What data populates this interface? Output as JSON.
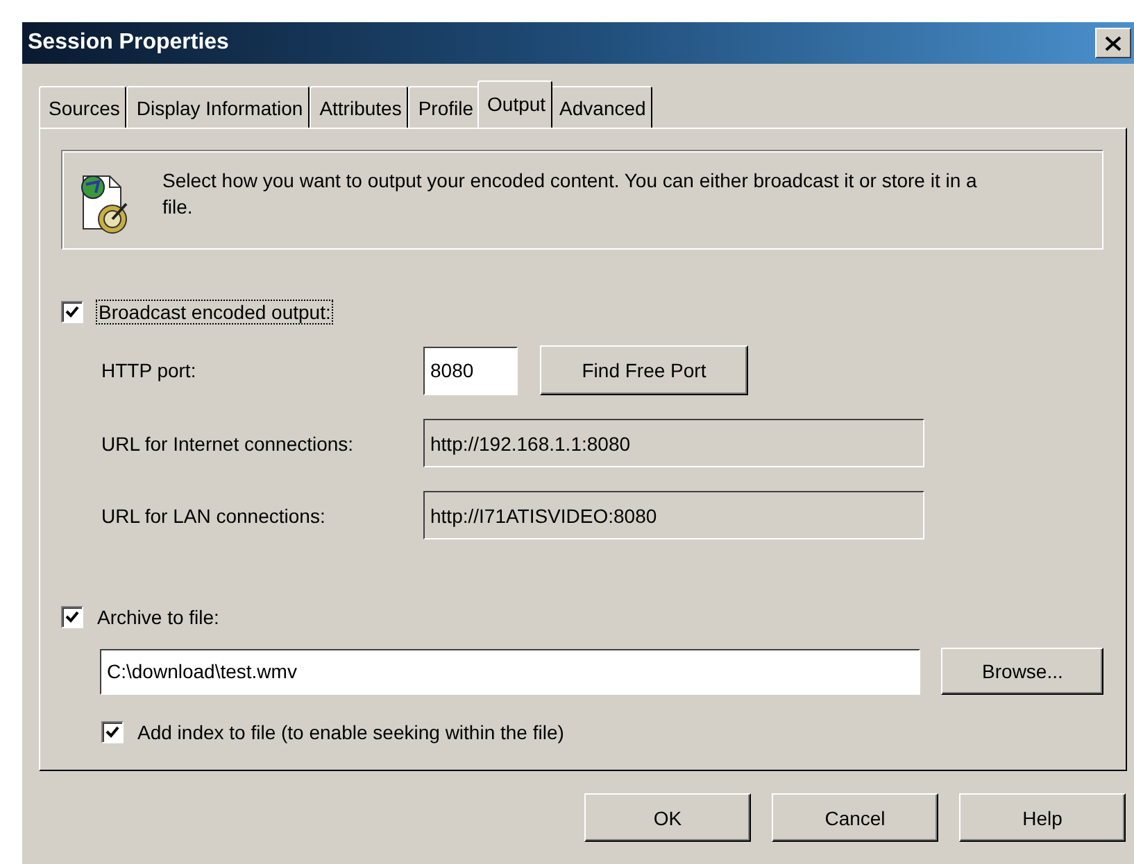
{
  "window": {
    "title": "Session Properties"
  },
  "tabs": [
    {
      "label": "Sources",
      "selected": false
    },
    {
      "label": "Display Information",
      "selected": false
    },
    {
      "label": "Attributes",
      "selected": false
    },
    {
      "label": "Profile",
      "selected": false
    },
    {
      "label": "Output",
      "selected": true
    },
    {
      "label": "Advanced",
      "selected": false
    }
  ],
  "info": {
    "text": "Select how you want to output your encoded content. You can either broadcast it or store it in a file."
  },
  "broadcast": {
    "label": "Broadcast encoded output:",
    "checked": true
  },
  "fields": [
    {
      "label": "HTTP port:",
      "value": "8080",
      "read_only": false,
      "button": "Find Free Port"
    },
    {
      "label": "URL for Internet connections:",
      "value": "http://192.168.1.1:8080",
      "read_only": true
    },
    {
      "label": "URL for LAN connections:",
      "value": "http://I71ATISVIDEO:8080",
      "read_only": true
    }
  ],
  "archive": {
    "label": "Archive to file:",
    "checked": true,
    "path": "C:\\download\\test.wmv",
    "browse": "Browse..."
  },
  "add_index": {
    "label": "Add index to file (to enable seeking within the file)",
    "checked": true
  },
  "buttons": [
    "OK",
    "Cancel",
    "Help"
  ]
}
